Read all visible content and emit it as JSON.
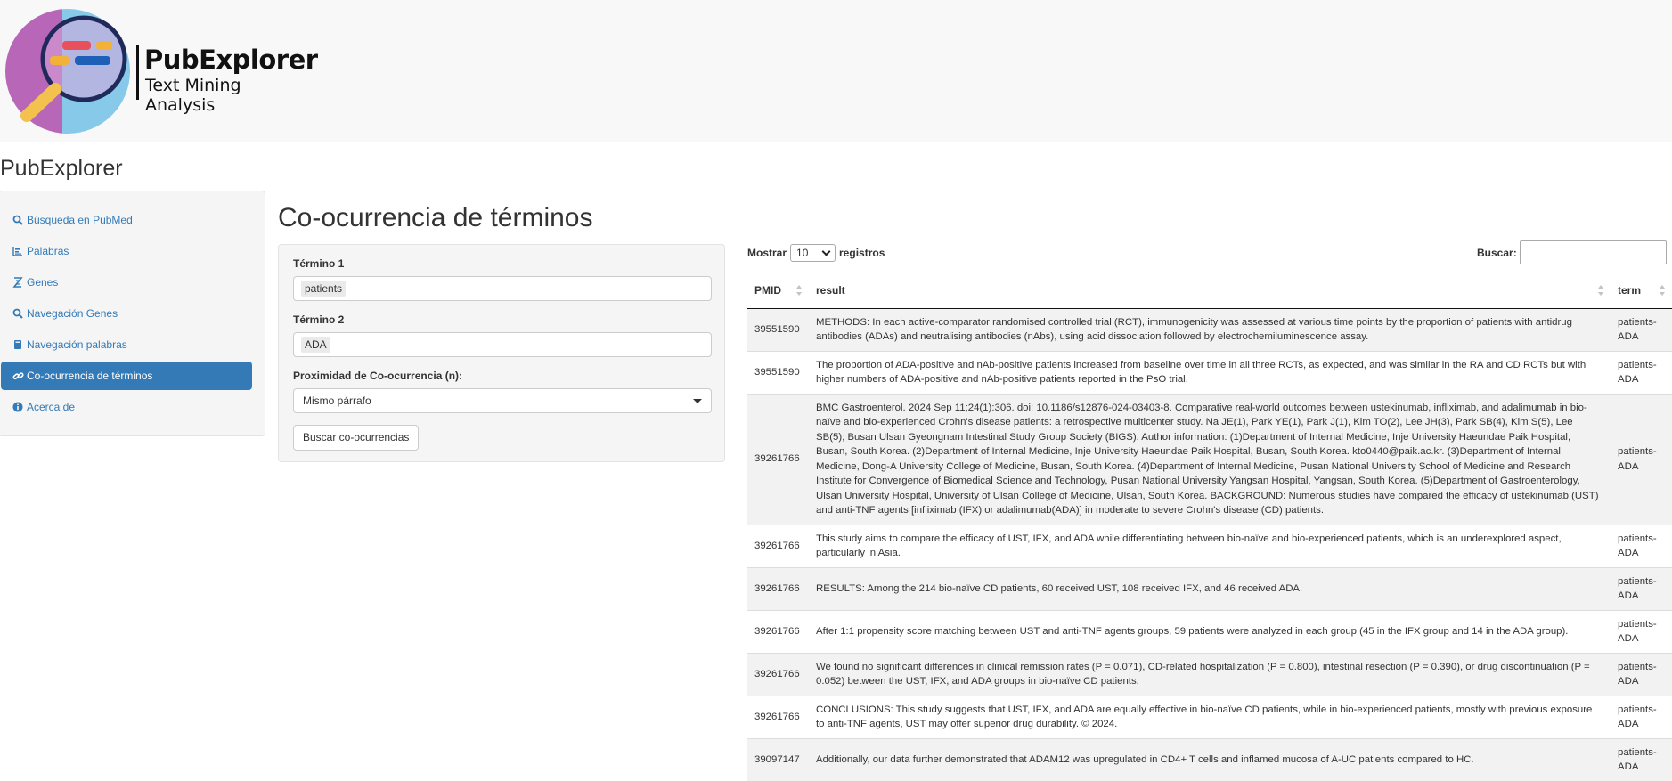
{
  "brand": {
    "name": "PubExplorer",
    "tagline": "Text Mining Analysis",
    "colors": {
      "circle_purple": "#b866b8",
      "circle_blue": "#7fc7e6",
      "handle": "#f2c14e",
      "accent": "#337ab7"
    }
  },
  "app_title": "PubExplorer",
  "sidebar": {
    "items": [
      {
        "label": "Búsqueda en PubMed",
        "icon": "search-icon",
        "active": false
      },
      {
        "label": "Palabras",
        "icon": "bar-chart-icon",
        "active": false
      },
      {
        "label": "Genes",
        "icon": "dna-icon",
        "active": false
      },
      {
        "label": "Navegación Genes",
        "icon": "search-icon",
        "active": false
      },
      {
        "label": "Navegación palabras",
        "icon": "book-icon",
        "active": false
      },
      {
        "label": "Co-ocurrencia de términos",
        "icon": "link-icon",
        "active": true
      },
      {
        "label": "Acerca de",
        "icon": "info-icon",
        "active": false
      }
    ]
  },
  "main": {
    "heading": "Co-ocurrencia de términos",
    "form": {
      "term1_label": "Término 1",
      "term1_value": "patients",
      "term2_label": "Término 2",
      "term2_value": "ADA",
      "proximity_label": "Proximidad de Co-ocurrencia (n):",
      "proximity_value": "Mismo párrafo",
      "submit_label": "Buscar co-ocurrencias"
    }
  },
  "table": {
    "length_prefix": "Mostrar",
    "length_value": "10",
    "length_suffix": "registros",
    "search_label": "Buscar:",
    "columns": [
      "PMID",
      "result",
      "term"
    ],
    "rows": [
      {
        "pmid": "39551590",
        "result": "METHODS: In each active-comparator randomised controlled trial (RCT), immunogenicity was assessed at various time points by the proportion of patients with antidrug antibodies (ADAs) and neutralising antibodies (nAbs), using acid dissociation followed by electrochemiluminescence assay.",
        "term": "patients-ADA"
      },
      {
        "pmid": "39551590",
        "result": "The proportion of ADA-positive and nAb-positive patients increased from baseline over time in all three RCTs, as expected, and was similar in the RA and CD RCTs but with higher numbers of ADA-positive and nAb-positive patients reported in the PsO trial.",
        "term": "patients-ADA"
      },
      {
        "pmid": "39261766",
        "result": "BMC Gastroenterol. 2024 Sep 11;24(1):306. doi: 10.1186/s12876-024-03403-8. Comparative real-world outcomes between ustekinumab, infliximab, and adalimumab in bio-naïve and bio-experienced Crohn's disease patients: a retrospective multicenter study. Na JE(1), Park YE(1), Park J(1), Kim TO(2), Lee JH(3), Park SB(4), Kim S(5), Lee SB(5); Busan Ulsan Gyeongnam Intestinal Study Group Society (BIGS). Author information: (1)Department of Internal Medicine, Inje University Haeundae Paik Hospital, Busan, South Korea. (2)Department of Internal Medicine, Inje University Haeundae Paik Hospital, Busan, South Korea. kto0440@paik.ac.kr. (3)Department of Internal Medicine, Dong-A University College of Medicine, Busan, South Korea. (4)Department of Internal Medicine, Pusan National University School of Medicine and Research Institute for Convergence of Biomedical Science and Technology, Pusan National University Yangsan Hospital, Yangsan, South Korea. (5)Department of Gastroenterology, Ulsan University Hospital, University of Ulsan College of Medicine, Ulsan, South Korea. BACKGROUND: Numerous studies have compared the efficacy of ustekinumab (UST) and anti-TNF agents [infliximab (IFX) or adalimumab(ADA)] in moderate to severe Crohn's disease (CD) patients.",
        "term": "patients-ADA"
      },
      {
        "pmid": "39261766",
        "result": "This study aims to compare the efficacy of UST, IFX, and ADA while differentiating between bio-naïve and bio-experienced patients, which is an underexplored aspect, particularly in Asia.",
        "term": "patients-ADA"
      },
      {
        "pmid": "39261766",
        "result": "RESULTS: Among the 214 bio-naïve CD patients, 60 received UST, 108 received IFX, and 46 received ADA.",
        "term": "patients-ADA"
      },
      {
        "pmid": "39261766",
        "result": "After 1:1 propensity score matching between UST and anti-TNF agents groups, 59 patients were analyzed in each group (45 in the IFX group and 14 in the ADA group).",
        "term": "patients-ADA"
      },
      {
        "pmid": "39261766",
        "result": "We found no significant differences in clinical remission rates (P = 0.071), CD-related hospitalization (P = 0.800), intestinal resection (P = 0.390), or drug discontinuation (P = 0.052) between the UST, IFX, and ADA groups in bio-naïve CD patients.",
        "term": "patients-ADA"
      },
      {
        "pmid": "39261766",
        "result": "CONCLUSIONS: This study suggests that UST, IFX, and ADA are equally effective in bio-naïve CD patients, while in bio-experienced patients, mostly with previous exposure to anti-TNF agents, UST may offer superior drug durability. © 2024.",
        "term": "patients-ADA"
      },
      {
        "pmid": "39097147",
        "result": "Additionally, our data further demonstrated that ADAM12 was upregulated in CD4+ T cells and inflamed mucosa of A-UC patients compared to HC.",
        "term": "patients-ADA"
      }
    ]
  }
}
